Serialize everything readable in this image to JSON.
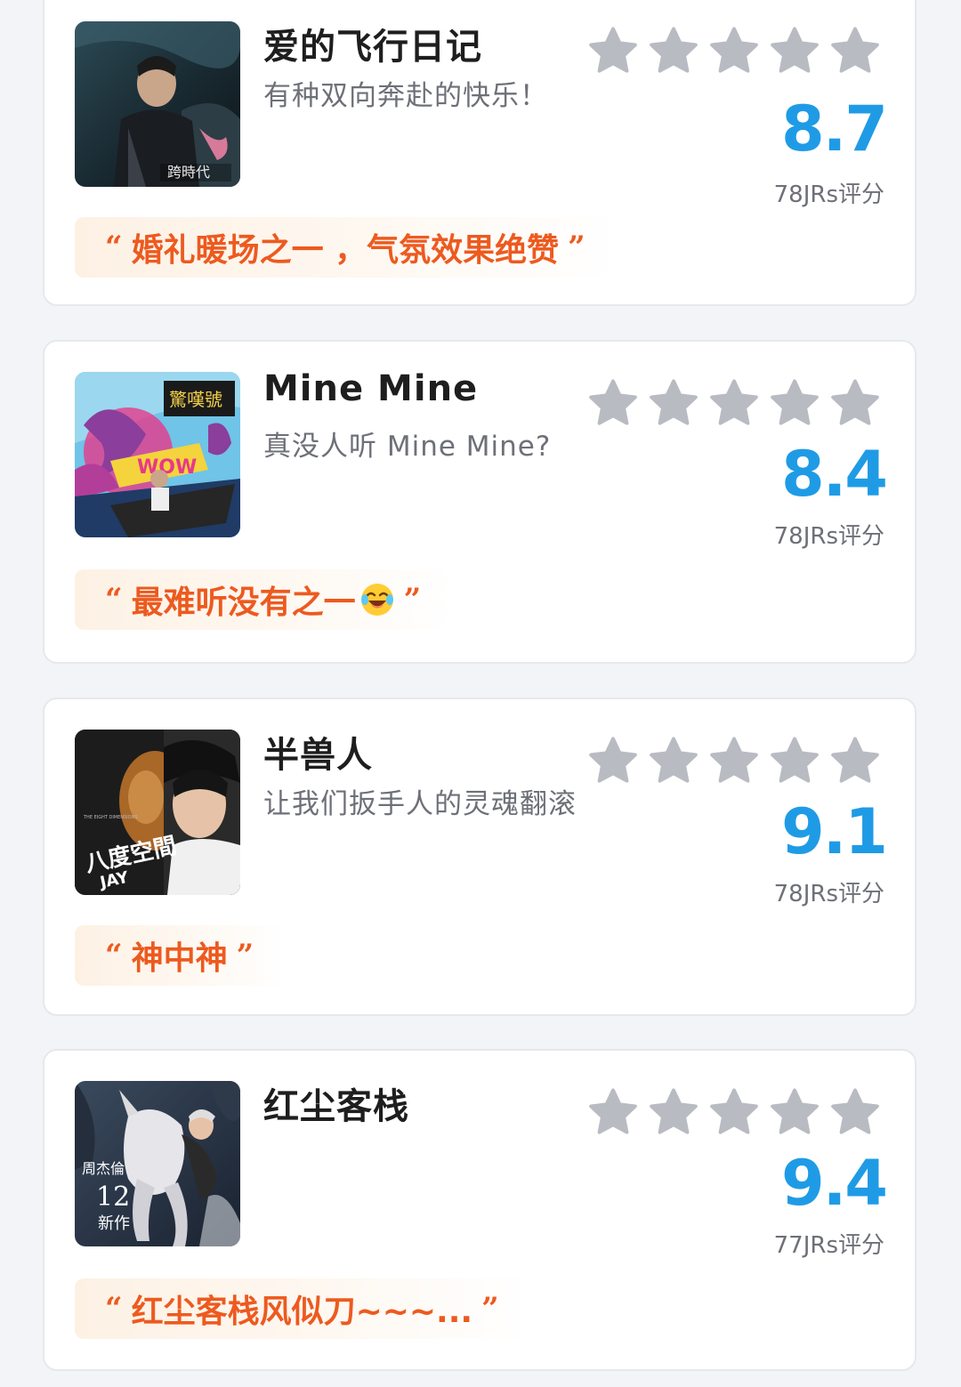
{
  "colors": {
    "accent_blue": "#1f9be6",
    "quote_orange": "#ed5a1f",
    "star_gray": "#b9bbc2"
  },
  "albums": [
    {
      "title": "爱的飞行日记",
      "subtitle": "有种双向奔赴的快乐！",
      "rating_stars": 5,
      "score": "8.7",
      "raters": "78JRs评分",
      "quote": "婚礼暖场之一 ，气氛效果绝赞",
      "quote_open": "“",
      "quote_close": "”",
      "cover_icon": "album-cover-image"
    },
    {
      "title": "Mine Mine",
      "subtitle": "真没人听 Mine Mine?",
      "rating_stars": 5,
      "score": "8.4",
      "raters": "78JRs评分",
      "quote": "最难听没有之一",
      "quote_emoji": "laughing-crying-emoji",
      "quote_open": "“",
      "quote_close": "”",
      "cover_icon": "album-cover-image"
    },
    {
      "title": "半兽人",
      "subtitle": "让我们扳手人的灵魂翻滚",
      "rating_stars": 5,
      "score": "9.1",
      "raters": "78JRs评分",
      "quote": "神中神",
      "quote_open": "“",
      "quote_close": "”",
      "cover_icon": "album-cover-image"
    },
    {
      "title": "红尘客栈",
      "subtitle": "",
      "rating_stars": 5,
      "score": "9.4",
      "raters": "77JRs评分",
      "quote": "红尘客栈风似刀~~~...",
      "quote_open": "“",
      "quote_close": "”",
      "cover_icon": "album-cover-image"
    }
  ]
}
